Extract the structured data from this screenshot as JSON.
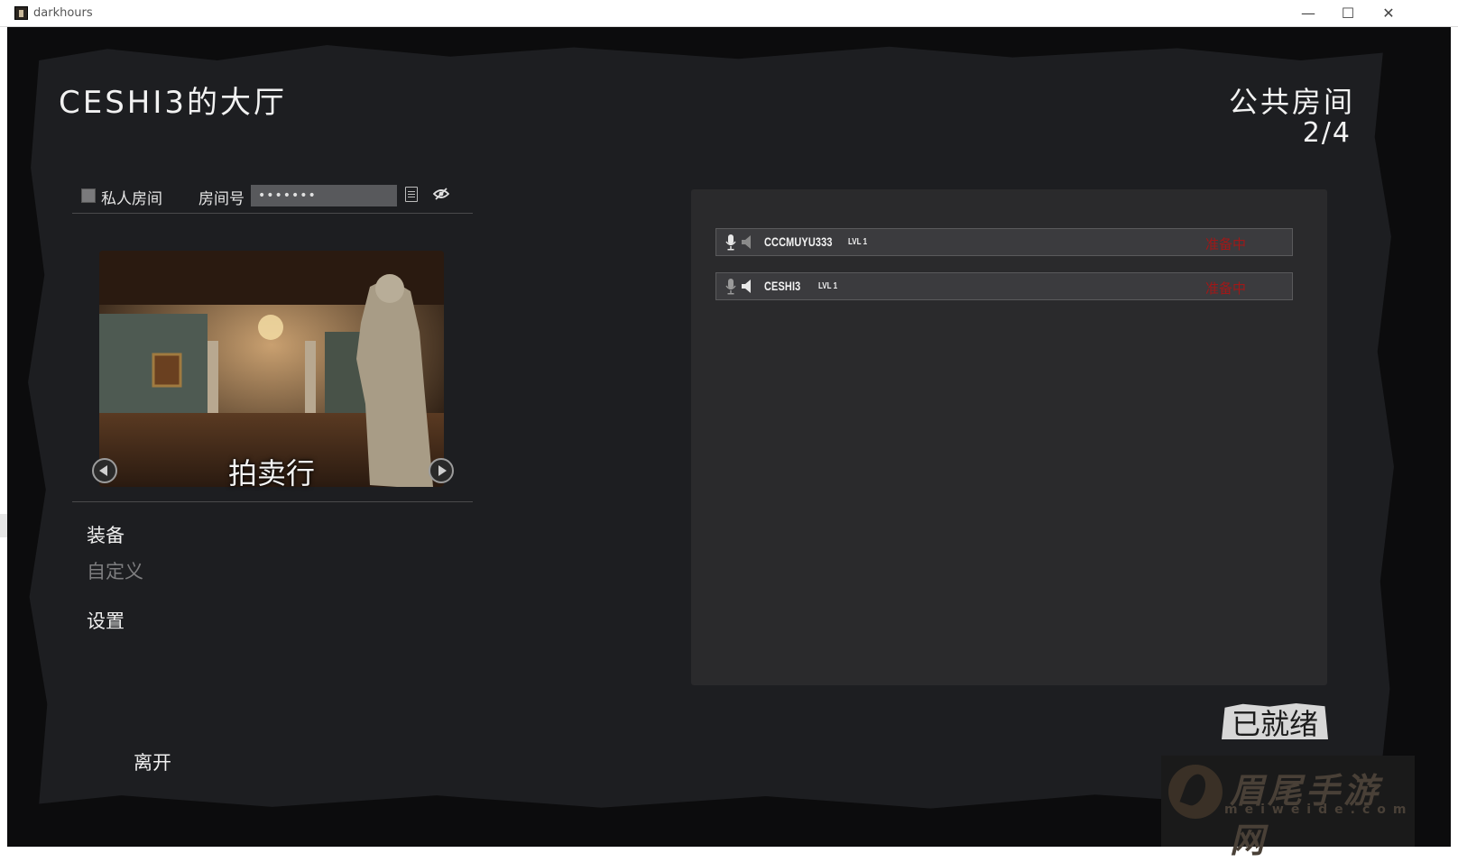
{
  "window": {
    "title": "darkhours",
    "minimize": "—",
    "maximize": "☐",
    "close": "✕"
  },
  "lobby": {
    "title": "CESHI3的大厅",
    "room_type": "公共房间",
    "player_count": "2/4"
  },
  "room_settings": {
    "private_label": "私人房间",
    "private_checked": false,
    "room_no_label": "房间号",
    "room_no_value": "•••••••"
  },
  "map": {
    "name": "拍卖行"
  },
  "menu": {
    "equip": "装备",
    "custom": "自定义",
    "settings": "设置",
    "leave": "离开"
  },
  "players": [
    {
      "name": "CCCMUYU333",
      "level": "LVL 1",
      "status": "准备中"
    },
    {
      "name": "CESHI3",
      "level": "LVL 1",
      "status": "准备中"
    }
  ],
  "ready_button": "已就绪",
  "watermark": {
    "text": "眉尾手游网",
    "url": "meiweide.com"
  },
  "colors": {
    "panel": "#1d1e21",
    "status": "#a01818",
    "text": "#f2f2f2"
  }
}
